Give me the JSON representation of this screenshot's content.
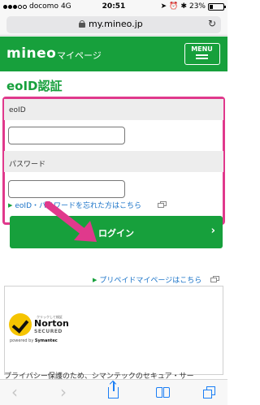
{
  "status_bar": {
    "carrier": "docomo",
    "network": "4G",
    "time": "20:51",
    "battery": "23%",
    "battery_level": 0.23
  },
  "browser": {
    "url": "my.mineo.jp",
    "reload_icon": "reload-icon"
  },
  "header": {
    "logo": "mineo",
    "subtitle": "マイページ",
    "menu_label": "MENU"
  },
  "page_title": "eoID認証",
  "form": {
    "eoid_label": "eoID",
    "eoid_value": "",
    "password_label": "パスワード",
    "password_value": "",
    "forgot_link": "eoID・パスワードを忘れた方はこちら"
  },
  "login_button": "ログイン",
  "prepaid_link": "プリペイドマイページはこちら",
  "norton": {
    "tiny_caption": "クリックして検証",
    "brand": "Norton",
    "secured": "SECURED",
    "powered_by": "powered by",
    "symantec": "Symantec",
    "description": "プライバシー保護のため、シマンテックのセキュア・サー"
  },
  "colors": {
    "brand_green": "#17a03c",
    "highlight_pink": "#e0398c",
    "link_blue": "#1a73c8",
    "ios_blue": "#1a7ef5"
  },
  "toolbar": {
    "items": [
      "back-icon",
      "forward-icon",
      "share-icon",
      "bookmarks-icon",
      "tabs-icon"
    ]
  }
}
